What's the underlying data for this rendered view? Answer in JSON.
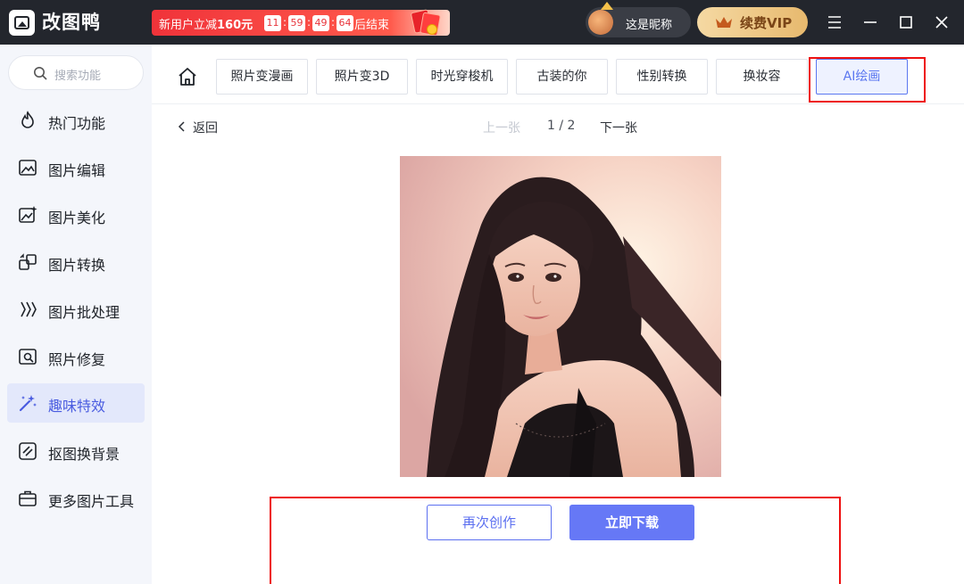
{
  "app": {
    "name": "改图鸭"
  },
  "promo": {
    "prefix": "新用户立减",
    "amount": "160元",
    "timer": [
      "11",
      "59",
      "49",
      "64"
    ],
    "suffix": "后结束"
  },
  "user": {
    "nickname": "这是昵称"
  },
  "vip": {
    "label": "续费VIP"
  },
  "search": {
    "placeholder": "搜索功能"
  },
  "sidebar": {
    "items": [
      {
        "label": "热门功能",
        "icon": "fire-icon"
      },
      {
        "label": "图片编辑",
        "icon": "image-edit-icon"
      },
      {
        "label": "图片美化",
        "icon": "image-beautify-icon"
      },
      {
        "label": "图片转换",
        "icon": "image-convert-icon"
      },
      {
        "label": "图片批处理",
        "icon": "batch-icon"
      },
      {
        "label": "照片修复",
        "icon": "photo-repair-icon"
      },
      {
        "label": "趣味特效",
        "icon": "magic-wand-icon",
        "active": true
      },
      {
        "label": "抠图换背景",
        "icon": "cutout-icon"
      },
      {
        "label": "更多图片工具",
        "icon": "toolbox-icon"
      }
    ]
  },
  "tabs": [
    {
      "label": "照片变漫画"
    },
    {
      "label": "照片变3D"
    },
    {
      "label": "时光穿梭机"
    },
    {
      "label": "古装的你"
    },
    {
      "label": "性别转换"
    },
    {
      "label": "换妆容"
    },
    {
      "label": "AI绘画",
      "active": true
    }
  ],
  "nav": {
    "back": "返回",
    "prev": "上一张",
    "pager": "1 / 2",
    "next": "下一张"
  },
  "actions": {
    "recreate": "再次创作",
    "download": "立即下载"
  },
  "colors": {
    "accent": "#5b6ff0",
    "titlebar": "#23262d",
    "highlight_box": "#e11111"
  }
}
